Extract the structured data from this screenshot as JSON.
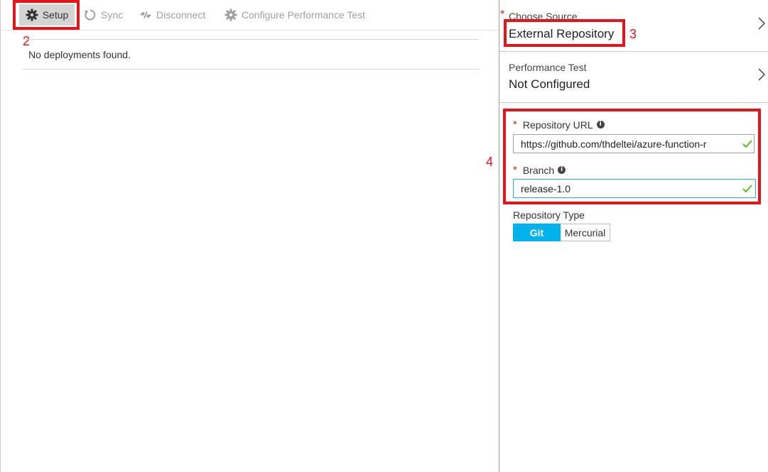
{
  "toolbar": {
    "setup_label": "Setup",
    "sync_label": "Sync",
    "disconnect_label": "Disconnect",
    "configure_perf_label": "Configure Performance Test"
  },
  "deployments": {
    "empty_message": "No deployments found."
  },
  "source": {
    "label": "Choose Source",
    "value": "External Repository"
  },
  "performance_test": {
    "label": "Performance Test",
    "value": "Not Configured"
  },
  "repository_url": {
    "label": "Repository URL",
    "value": "https://github.com/thdeltei/azure-function-r"
  },
  "branch": {
    "label": "Branch",
    "value": "release-1.0"
  },
  "repository_type": {
    "label": "Repository Type",
    "options": [
      "Git",
      "Mercurial"
    ],
    "selected": "Git"
  },
  "annotations": [
    "2",
    "3",
    "4"
  ],
  "colors": {
    "accent": "#00b2ec",
    "annotation": "#e3151a",
    "required": "#c7291b",
    "valid_check": "#5cb82c"
  }
}
